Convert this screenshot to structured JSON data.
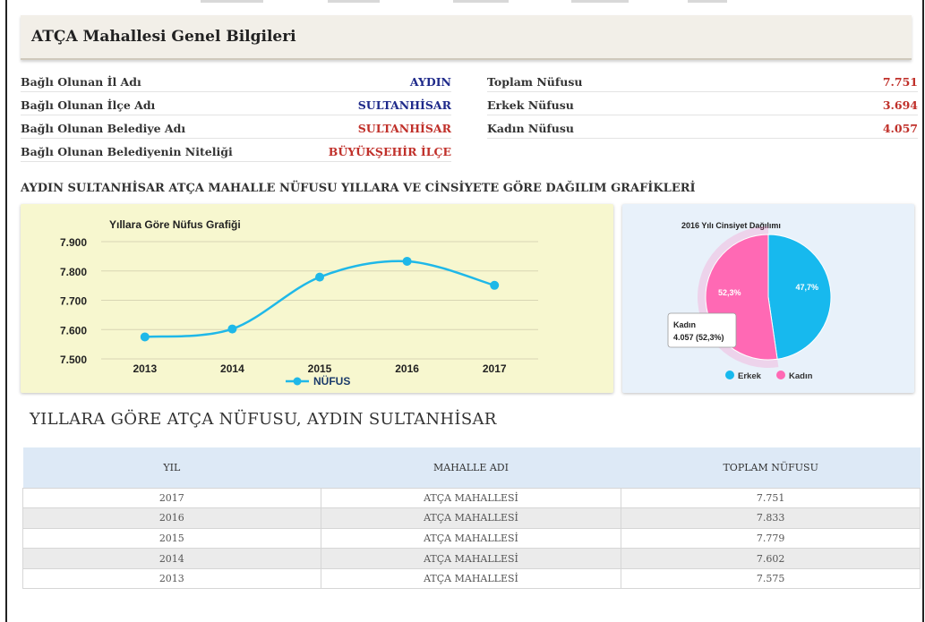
{
  "page_title": "ATÇA Mahallesi Genel Bilgileri",
  "info_left": [
    {
      "label": "Bağlı Olunan İl Adı",
      "value": "AYDIN",
      "color": "#1f2a8a"
    },
    {
      "label": "Bağlı Olunan İlçe Adı",
      "value": "SULTANHİSAR",
      "color": "#1f2a8a"
    },
    {
      "label": "Bağlı Olunan Belediye Adı",
      "value": "SULTANHİSAR",
      "color": "#c0302a"
    },
    {
      "label": "Bağlı Olunan Belediyenin Niteliği",
      "value": "BÜYÜKŞEHİR İLÇE",
      "color": "#c0302a"
    }
  ],
  "info_right": [
    {
      "label": "Toplam Nüfusu",
      "value": "7.751",
      "color": "#c0302a"
    },
    {
      "label": "Erkek Nüfusu",
      "value": "3.694",
      "color": "#c0302a"
    },
    {
      "label": "Kadın Nüfusu",
      "value": "4.057",
      "color": "#c0302a"
    }
  ],
  "section_title": "AYDIN SULTANHİSAR ATÇA MAHALLE NÜFUSU YILLARA VE CİNSİYETE GÖRE DAĞILIM GRAFİKLERİ",
  "chart_data": [
    {
      "type": "line",
      "title": "Yıllara Göre Nüfus Grafiği",
      "categories": [
        "2013",
        "2014",
        "2015",
        "2016",
        "2017"
      ],
      "series": [
        {
          "name": "NÜFUS",
          "values": [
            7575,
            7602,
            7779,
            7833,
            7751
          ],
          "color": "#1fb8e8"
        }
      ],
      "ylim": [
        7500,
        7900
      ],
      "yticks": [
        "7.500",
        "7.600",
        "7.700",
        "7.800",
        "7.900"
      ],
      "legend": "bottom"
    },
    {
      "type": "pie",
      "title": "2016 Yılı Cinsiyet Dağılımı",
      "slices": [
        {
          "name": "Erkek",
          "value": 47.7,
          "label": "47,7%",
          "color": "#17b9ee"
        },
        {
          "name": "Kadın",
          "value": 52.3,
          "label": "52,3%",
          "color": "#ff69b4"
        }
      ],
      "tooltip": {
        "title": "Kadın",
        "text": "4.057 (52,3%)"
      },
      "legend": "bottom"
    }
  ],
  "table_title": "YILLARA GÖRE ATÇA NÜFUSU, AYDIN SULTANHİSAR",
  "table": {
    "headers": [
      "YIL",
      "MAHALLE ADI",
      "TOPLAM NÜFUSU"
    ],
    "rows": [
      [
        "2017",
        "ATÇA MAHALLESİ",
        "7.751"
      ],
      [
        "2016",
        "ATÇA MAHALLESİ",
        "7.833"
      ],
      [
        "2015",
        "ATÇA MAHALLESİ",
        "7.779"
      ],
      [
        "2014",
        "ATÇA MAHALLESİ",
        "7.602"
      ],
      [
        "2013",
        "ATÇA MAHALLESİ",
        "7.575"
      ]
    ]
  }
}
